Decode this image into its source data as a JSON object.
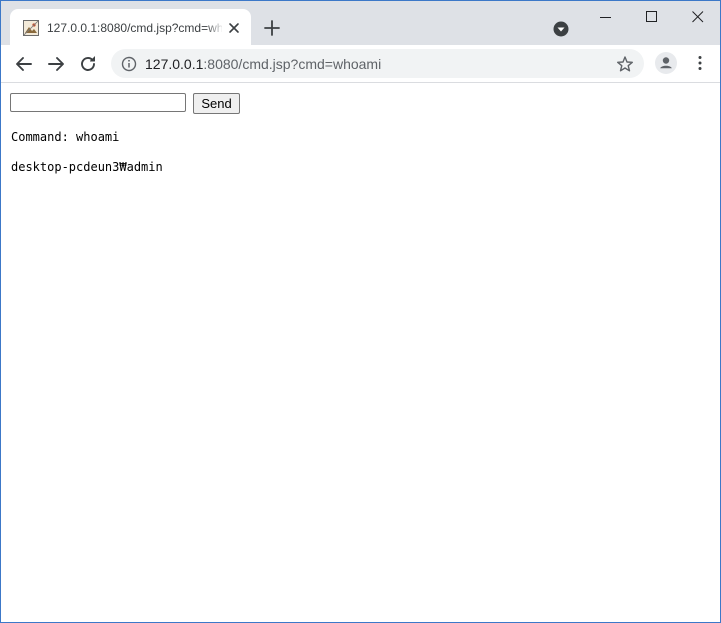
{
  "browser": {
    "tab": {
      "title": "127.0.0.1:8080/cmd.jsp?cmd=whoami"
    },
    "address_bar": {
      "host": "127.0.0.1",
      "path": ":8080/cmd.jsp?cmd=whoami"
    }
  },
  "page": {
    "input": {
      "value": "",
      "placeholder": ""
    },
    "send_label": "Send",
    "command_line": "Command: whoami",
    "output_line": "desktop-pcdeun3₩admin"
  },
  "colors": {
    "frame": "#dee1e6",
    "window_border": "#3c78c8",
    "omnibox_bg": "#f1f3f4"
  }
}
